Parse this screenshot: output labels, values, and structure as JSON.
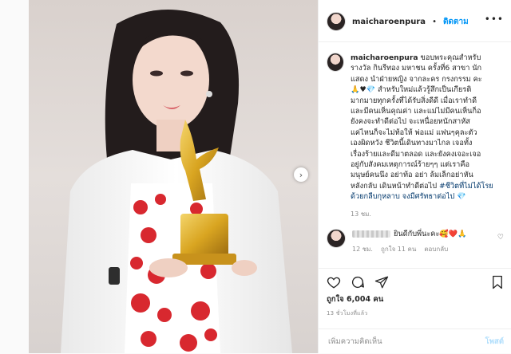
{
  "header": {
    "username": "maicharoenpura",
    "separator": "•",
    "follow_label": "ติดตาม",
    "more_icon": "more-horizontal-icon"
  },
  "caption": {
    "username": "maicharoenpura",
    "lines": [
      "ขอบพระคุณสำหรับ",
      "รางวัล กินรีทอง มหาชน ครั้งที่6 สาขา นัก",
      "แสดง นำฝ่ายหญิง จากละคร กรงกรรม คะ",
      "🙏♥💎 สำหรับใหม่แล้วรู้สึกเป็นเกียรติ",
      "มากมายทุกครั้งที่ได้รับสิ่งดีดี เมื่อเราทำดี",
      "และมีคนเห็นคุณค่า และแม่ไม่มีคนเห็นก็อ",
      "ยังคงจะทำดีต่อไป จะเหนื่อยหนักสาหัส",
      "แค่ไหนก็จะไม่ท้อให้ พ่อแม่ แฟนๆคุละตัว",
      "เองผิดหวัง ชีวิตนี้เดินทางมาไกล เจอทั้ง",
      "เรื่องร้ายและดีมาตลอด และยังคงเจอะเจอ",
      "อยู่กับสังคมเหตุการณ์ร้ายๆๆ แต่เราคือ",
      "มนุษย์คนนึง อย่าท้อ อย่า ล้มเล็กอย่าหัน",
      "หลังกลับ เดินหน้าทำดีต่อไป"
    ],
    "hashtag": "#ชีวิตที่ไม่ได้โรยด้วยกลีบกุหลาบ จงมีศรัทธาต่อไป",
    "emoji_end": "💎",
    "time": "13 ชม."
  },
  "comment": {
    "text": "ยินดีกับพี่นะคะ🥰❤️🙏",
    "time": "12 ชม.",
    "likes": "ถูกใจ 11 คน",
    "reply": "ตอบกลับ"
  },
  "actions": {
    "like_icon": "heart-icon",
    "comment_icon": "comment-icon",
    "share_icon": "send-icon",
    "save_icon": "bookmark-icon"
  },
  "likes_text": "ถูกใจ 6,004 คน",
  "time_ago": "13 ชั่วโมงที่แล้ว",
  "add_comment": {
    "placeholder": "เพิ่มความคิดเห็น",
    "post_label": "โพสต์"
  },
  "colors": {
    "follow": "#0095f6",
    "post_disabled": "#b2dffc",
    "hashtag": "#00376b",
    "dress_red": "#d8282f",
    "trophy_gold": "#d9a521"
  }
}
